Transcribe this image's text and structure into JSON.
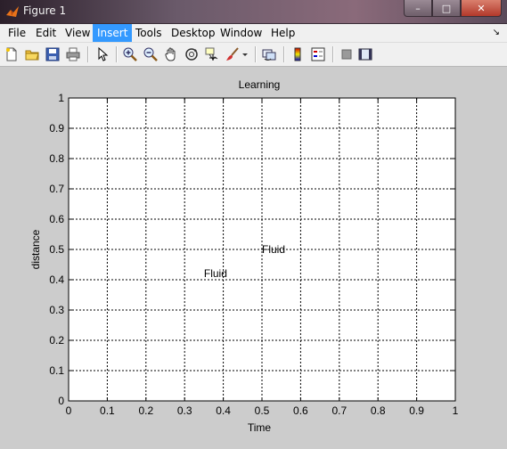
{
  "window": {
    "title": "Figure 1",
    "minimize_glyph": "–",
    "maximize_glyph": "□",
    "close_glyph": "✕"
  },
  "menu": {
    "items": [
      {
        "label": "File"
      },
      {
        "label": "Edit"
      },
      {
        "label": "View"
      },
      {
        "label": "Insert",
        "active": true
      },
      {
        "label": "Tools"
      },
      {
        "label": "Desktop"
      },
      {
        "label": "Window"
      },
      {
        "label": "Help"
      }
    ],
    "overflow_glyph": "↘"
  },
  "toolbar": {
    "icons": [
      "new-file-icon",
      "open-folder-icon",
      "save-icon",
      "print-icon",
      "pointer-icon",
      "zoom-in-icon",
      "zoom-out-icon",
      "pan-hand-icon",
      "rotate-3d-icon",
      "data-cursor-icon",
      "brush-icon",
      "brush-dropdown-icon",
      "link-plot-icon",
      "colorbar-icon",
      "legend-icon",
      "hide-plot-tools-icon",
      "show-plot-tools-icon"
    ]
  },
  "chart_data": {
    "type": "scatter",
    "title": "Learning",
    "xlabel": "Time",
    "ylabel": "distance",
    "xlim": [
      0,
      1
    ],
    "ylim": [
      0,
      1
    ],
    "xticks": [
      "0",
      "0.1",
      "0.2",
      "0.3",
      "0.4",
      "0.5",
      "0.6",
      "0.7",
      "0.8",
      "0.9",
      "1"
    ],
    "yticks": [
      "0",
      "0.1",
      "0.2",
      "0.3",
      "0.4",
      "0.5",
      "0.6",
      "0.7",
      "0.8",
      "0.9",
      "1"
    ],
    "grid": true,
    "annotations": [
      {
        "text": "Fluid",
        "x": 0.5,
        "y": 0.5
      },
      {
        "text": "Fluid",
        "x": 0.35,
        "y": 0.42
      }
    ],
    "colors": {
      "axes_bg": "#ffffff",
      "figure_bg": "#cccccc",
      "grid": "#000000"
    }
  }
}
